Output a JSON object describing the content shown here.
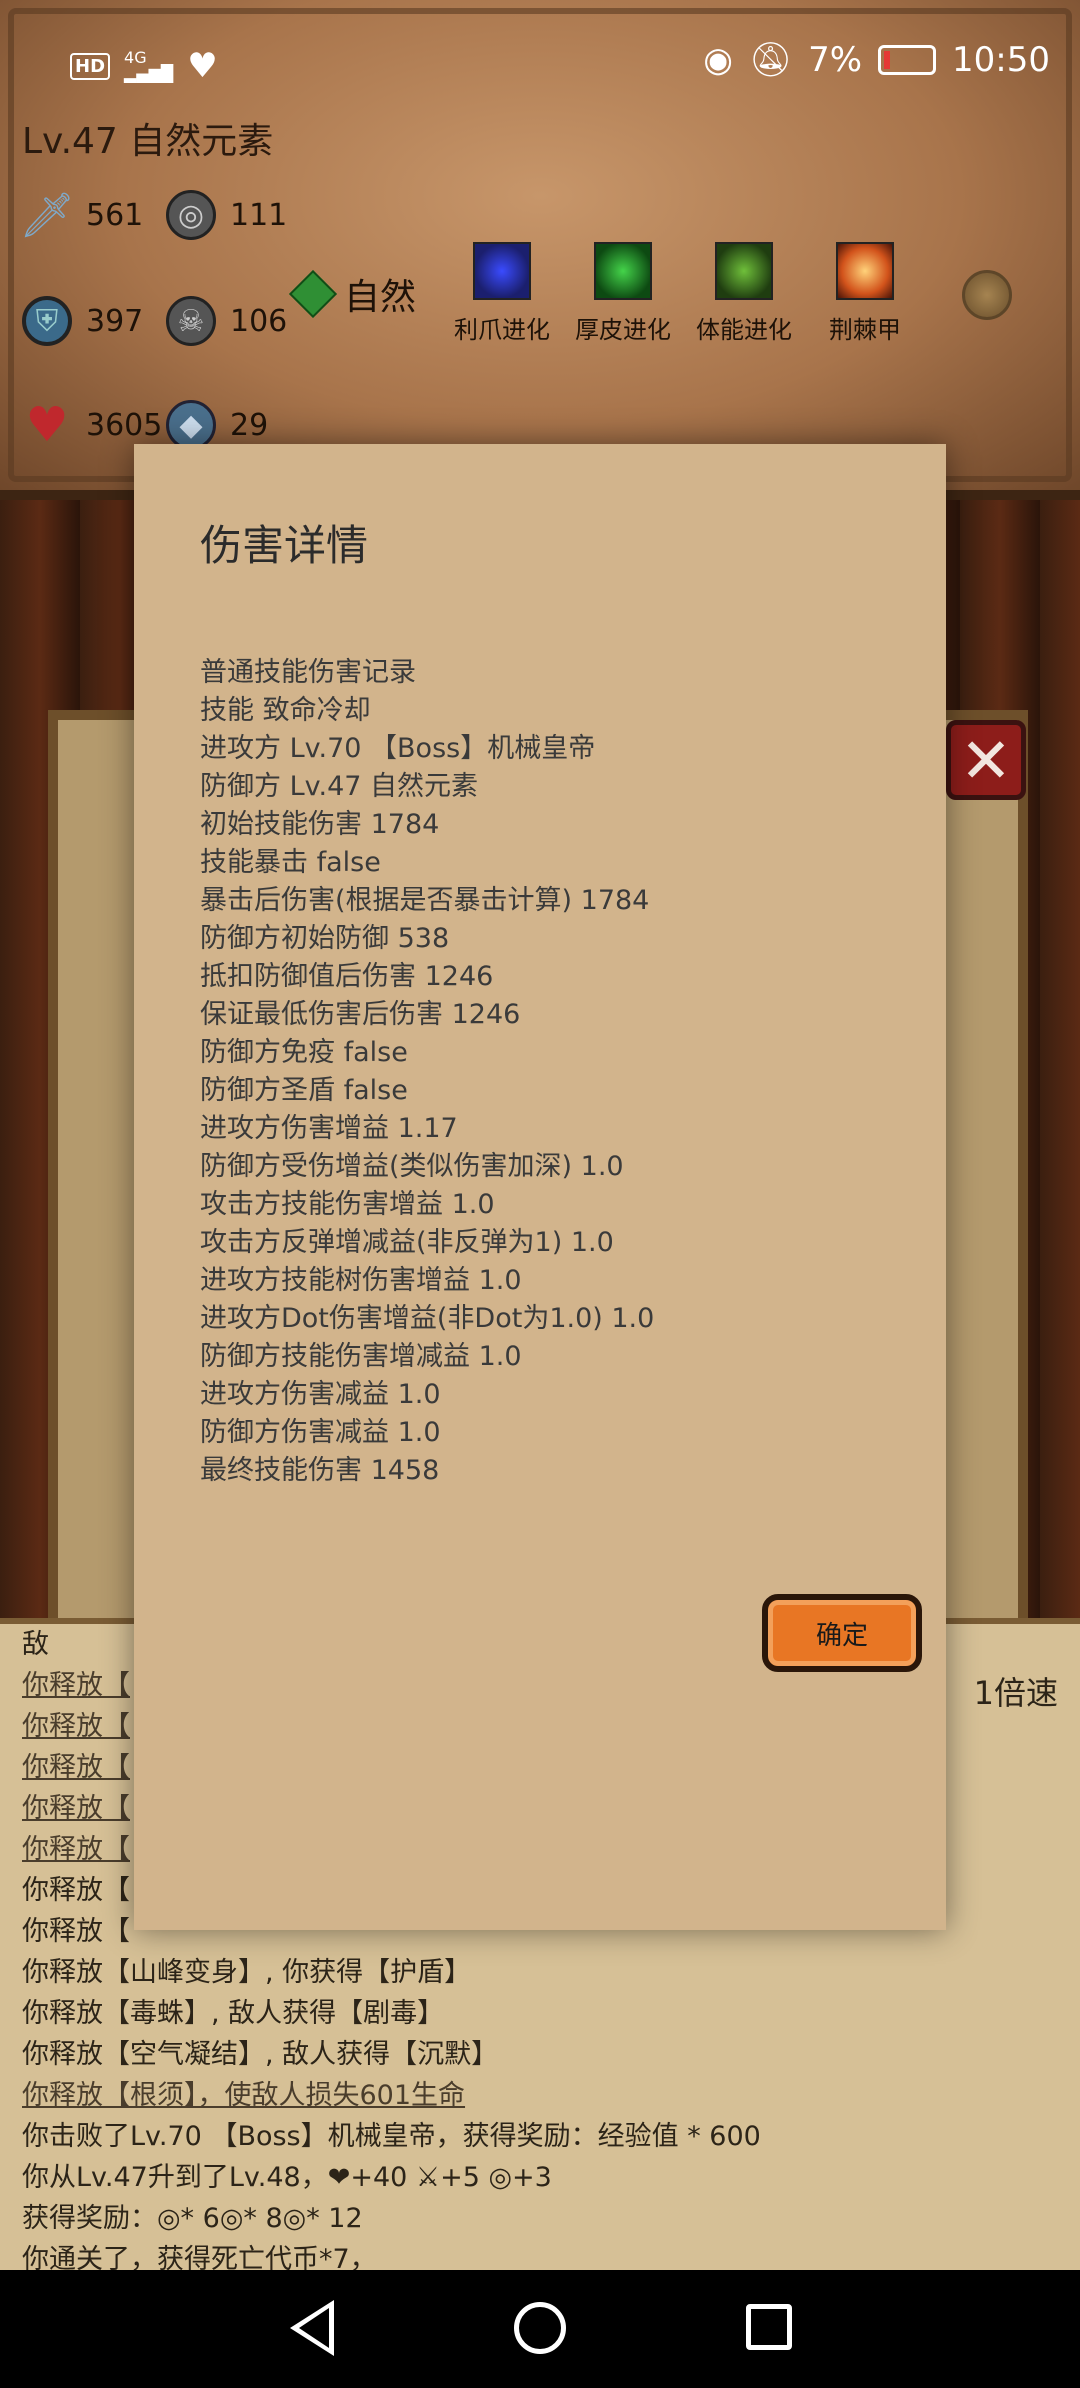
{
  "status_bar": {
    "hd": "HD",
    "network": "4G",
    "battery_percent": "7%",
    "battery_level": 0.07,
    "time": "10:50"
  },
  "character": {
    "level_title": "Lv.47 自然元素",
    "attack": "561",
    "coin1": "111",
    "defense": "397",
    "coin2": "106",
    "hp": "3605",
    "gem": "29",
    "element": "自然"
  },
  "skills": [
    {
      "label": "利爪进化",
      "icon": "claw-evolution-icon"
    },
    {
      "label": "厚皮进化",
      "icon": "thick-skin-icon"
    },
    {
      "label": "体能进化",
      "icon": "stamina-icon"
    },
    {
      "label": "荆棘甲",
      "icon": "thorn-armor-icon"
    }
  ],
  "dialog": {
    "title": "伤害详情",
    "lines": [
      "普通技能伤害记录",
      "技能 致命冷却",
      "进攻方 Lv.70 【Boss】机械皇帝",
      "防御方 Lv.47 自然元素",
      "初始技能伤害 1784",
      "技能暴击 false",
      "暴击后伤害(根据是否暴击计算) 1784",
      "防御方初始防御 538",
      "抵扣防御值后伤害 1246",
      "保证最低伤害后伤害 1246",
      "防御方免疫 false",
      "防御方圣盾 false",
      "进攻方伤害增益 1.17",
      "防御方受伤增益(类似伤害加深) 1.0",
      "攻击方技能伤害增益 1.0",
      "攻击方反弹增减益(非反弹为1) 1.0",
      "进攻方技能树伤害增益 1.0",
      "进攻方Dot伤害增益(非Dot为1.0) 1.0",
      "防御方技能伤害增减益 1.0",
      "进攻方伤害减益 1.0",
      "防御方伤害减益 1.0",
      "最终技能伤害 1458"
    ],
    "ok_label": "确定"
  },
  "battle_log": {
    "speed": "1倍速",
    "lines": [
      {
        "text": "敌",
        "underline": false
      },
      {
        "text": "你释放【",
        "underline": true
      },
      {
        "text": "你释放【",
        "underline": true
      },
      {
        "text": "你释放【",
        "underline": true
      },
      {
        "text": "你释放【",
        "underline": true
      },
      {
        "text": "你释放【",
        "underline": true
      },
      {
        "text": "你释放【",
        "underline": false
      },
      {
        "text": "你释放【",
        "underline": false
      },
      {
        "text": "你释放【山峰变身】, 你获得【护盾】",
        "underline": false
      },
      {
        "text": "你释放【毒蛛】, 敌人获得【剧毒】",
        "underline": false
      },
      {
        "text": "你释放【空气凝结】, 敌人获得【沉默】",
        "underline": false
      },
      {
        "text": "你释放【根须】，使敌人损失601生命",
        "underline": true
      },
      {
        "text": "你击败了Lv.70 【Boss】机械皇帝，获得奖励：经验值 * 600",
        "underline": false
      },
      {
        "text": "你从Lv.47升到了Lv.48，❤+40 ⚔+5 ◎+3",
        "underline": false
      },
      {
        "text": "获得奖励：◎* 6◎* 8◎* 12",
        "underline": false
      },
      {
        "text": "你通关了，获得死亡代币*7，",
        "underline": false
      }
    ]
  },
  "colors": {
    "dialog_bg": "#d2b48c",
    "ok_button": "#e87624",
    "close_button": "#8d1d1a"
  }
}
